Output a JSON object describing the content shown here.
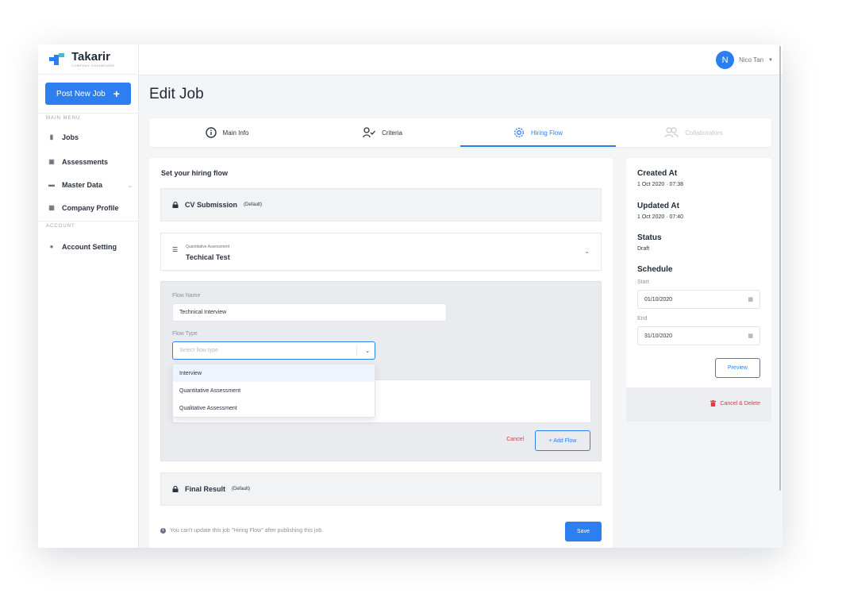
{
  "brand": {
    "name": "Takarir",
    "subtitle": "COMPANY DASHBOARD",
    "colors": {
      "accent": "#2d7ff0",
      "danger": "#e03a3a"
    }
  },
  "sidebar": {
    "post_button": "Post New Job",
    "post_button_icon": "+",
    "main_menu_label": "MAIN MENU",
    "items": [
      {
        "label": "Jobs",
        "icon": "briefcase-icon"
      },
      {
        "label": "Assessments",
        "icon": "clipboard-icon"
      },
      {
        "label": "Master Data",
        "icon": "folder-icon"
      },
      {
        "label": "Company Profile",
        "icon": "building-icon"
      }
    ],
    "account_label": "ACCOUNT",
    "account_items": [
      {
        "label": "Account Setting",
        "icon": "user-settings-icon"
      }
    ]
  },
  "topbar": {
    "avatar_initial": "N",
    "user_name": "Nico Tan"
  },
  "page": {
    "title": "Edit Job"
  },
  "tabs": [
    {
      "label": "Main Info",
      "icon": "info-icon"
    },
    {
      "label": "Criteria",
      "icon": "person-check-icon"
    },
    {
      "label": "Hiring Flow",
      "icon": "gear-icon",
      "active": true
    },
    {
      "label": "Collaborators",
      "icon": "users-icon",
      "disabled": true
    }
  ],
  "hiring": {
    "title": "Set your hiring flow",
    "cv": {
      "name": "CV Submission",
      "tag": "(Default)"
    },
    "flow_item": {
      "type": "Quantitative Assessment",
      "name": "Techical Test"
    },
    "form": {
      "flow_name_label": "Flow Name",
      "flow_name_value": "Technical Interview",
      "flow_type_label": "Flow Type",
      "flow_type_placeholder": "Select flow type",
      "options": [
        "Interview",
        "Quantitative Assessment",
        "Qualitative Assessment"
      ],
      "cancel": "Cancel",
      "add_flow": "+ Add Flow"
    },
    "final": {
      "name": "Final Result",
      "tag": "(Default)"
    },
    "note": "You can't update this job \"Hiring Flow\" after publishing this job.",
    "save": "Save"
  },
  "details": {
    "created_label": "Created At",
    "created_value": "1 Oct 2020 · 07:38",
    "updated_label": "Updated At",
    "updated_value": "1 Oct 2020 · 07:40",
    "status_label": "Status",
    "status_value": "Draft",
    "schedule_label": "Schedule",
    "start_label": "Start",
    "start_value": "01/10/2020",
    "end_label": "End",
    "end_value": "31/10/2020",
    "preview": "Preview",
    "delete": "Cancel & Delete"
  }
}
